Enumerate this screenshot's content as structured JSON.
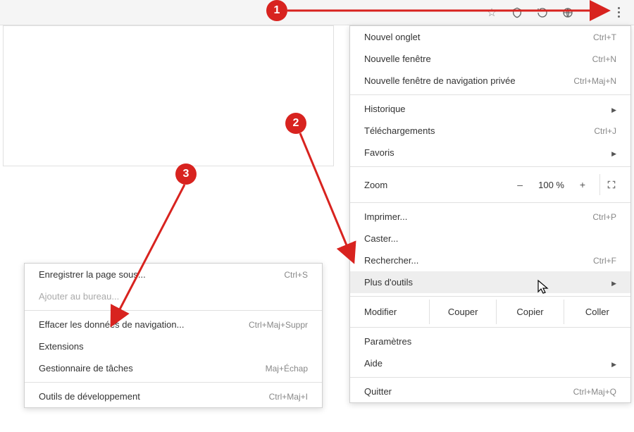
{
  "toolbar": {
    "icons": [
      "star-icon",
      "shield-icon",
      "refresh-icon",
      "globe-icon",
      "lock-icon",
      "kebab-menu-icon"
    ]
  },
  "mainMenu": {
    "new_tab": "Nouvel onglet",
    "new_tab_sc": "Ctrl+T",
    "new_window": "Nouvelle fenêtre",
    "new_window_sc": "Ctrl+N",
    "incognito": "Nouvelle fenêtre de navigation privée",
    "incognito_sc": "Ctrl+Maj+N",
    "history": "Historique",
    "downloads": "Téléchargements",
    "downloads_sc": "Ctrl+J",
    "bookmarks": "Favoris",
    "zoom_label": "Zoom",
    "zoom_minus": "–",
    "zoom_value": "100 %",
    "zoom_plus": "+",
    "print": "Imprimer...",
    "print_sc": "Ctrl+P",
    "cast": "Caster...",
    "find": "Rechercher...",
    "find_sc": "Ctrl+F",
    "more_tools": "Plus d'outils",
    "edit_label": "Modifier",
    "cut": "Couper",
    "copy": "Copier",
    "paste": "Coller",
    "settings": "Paramètres",
    "help": "Aide",
    "quit": "Quitter",
    "quit_sc": "Ctrl+Maj+Q"
  },
  "subMenu": {
    "save_page": "Enregistrer la page sous...",
    "save_page_sc": "Ctrl+S",
    "add_desktop": "Ajouter au bureau...",
    "clear_data": "Effacer les données de navigation...",
    "clear_data_sc": "Ctrl+Maj+Suppr",
    "extensions": "Extensions",
    "task_manager": "Gestionnaire de tâches",
    "task_manager_sc": "Maj+Échap",
    "devtools": "Outils de développement",
    "devtools_sc": "Ctrl+Maj+I"
  },
  "steps": {
    "one": "1",
    "two": "2",
    "three": "3"
  }
}
